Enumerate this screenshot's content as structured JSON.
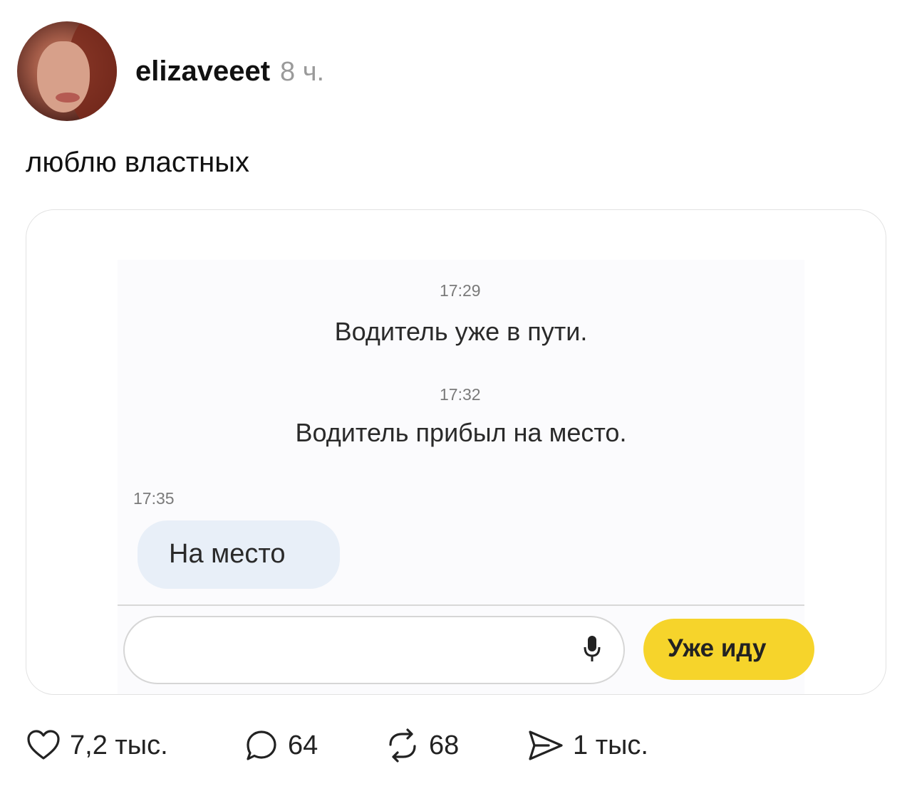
{
  "post": {
    "username": "elizaveeet",
    "time_ago": "8 ч.",
    "text": "люблю властных"
  },
  "chat": {
    "ts1": "17:29",
    "msg1": "Водитель уже в пути.",
    "ts2": "17:32",
    "msg2": "Водитель прибыл на место.",
    "ts3": "17:35",
    "bubble": "На место",
    "button": "Уже иду",
    "colors": {
      "button_bg": "#f6d42b",
      "bubble_bg": "#e8eff8"
    }
  },
  "actions": {
    "likes": "7,2 тыс.",
    "comments": "64",
    "reposts": "68",
    "shares": "1 тыс."
  },
  "icons": [
    "heart-icon",
    "comment-icon",
    "repost-icon",
    "send-icon",
    "microphone-icon"
  ]
}
